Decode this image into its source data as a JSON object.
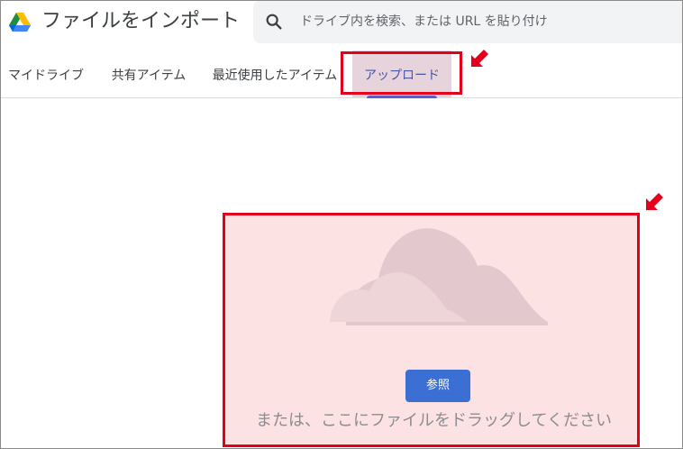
{
  "header": {
    "title": "ファイルをインポート",
    "search_placeholder": "ドライブ内を検索、または URL を貼り付け"
  },
  "tabs": [
    {
      "label": "マイドライブ"
    },
    {
      "label": "共有アイテム"
    },
    {
      "label": "最近使用したアイテム"
    },
    {
      "label": "アップロード",
      "selected": true
    }
  ],
  "upload": {
    "browse_label": "参照",
    "drag_text": "または、ここにファイルをドラッグしてください"
  },
  "colors": {
    "annotation": "#e4001b",
    "accent": "#5b5fc0",
    "button": "#3b6fd4",
    "dropzone_bg": "#fde2e4"
  },
  "icons": {
    "logo": "google-drive-logo",
    "search": "search-icon",
    "illustration": "cloud-illustration",
    "annotation_arrow": "red-arrow-icon"
  }
}
